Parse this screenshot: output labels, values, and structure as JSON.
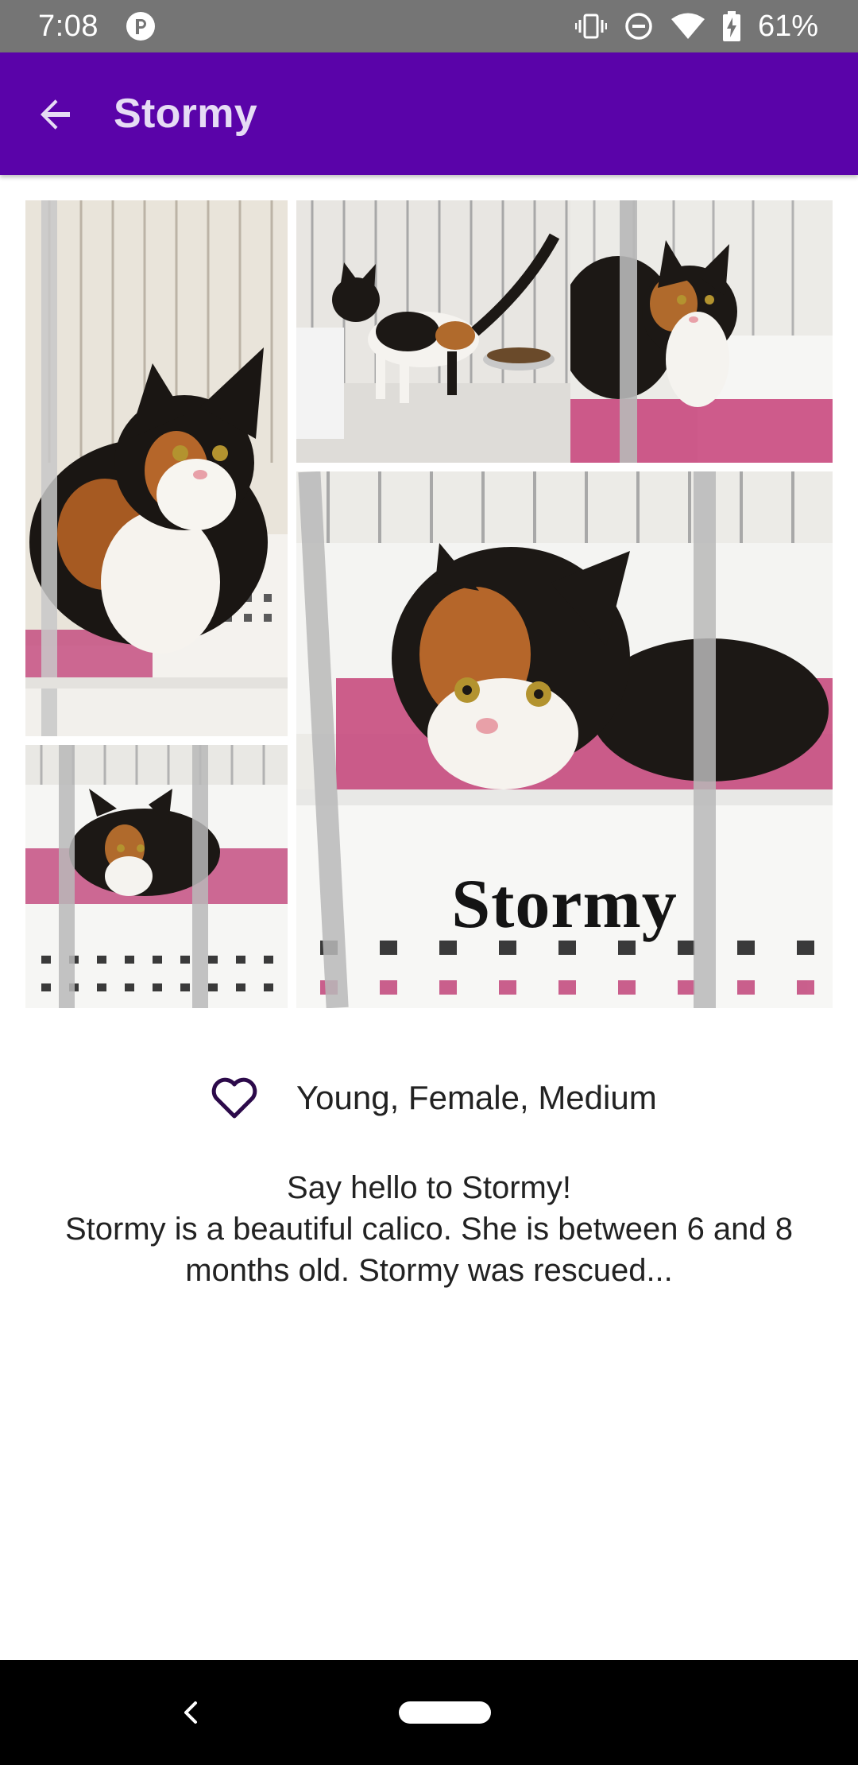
{
  "status_bar": {
    "time": "7:08",
    "battery": "61%",
    "icons": [
      "app-notification-icon",
      "vibrate-icon",
      "do-not-disturb-icon",
      "wifi-icon",
      "battery-charging-icon"
    ]
  },
  "app_bar": {
    "title": "Stormy",
    "back_icon": "arrow-back-icon"
  },
  "gallery": {
    "photo_count": 5,
    "watermark_text": "Stormy"
  },
  "details": {
    "attributes": "Young, Female, Medium",
    "favorite_icon": "heart-outline-icon",
    "description": "Say hello to Stormy!\nStormy is a beautiful calico.  She is between 6 and 8 months old.  Stormy was rescued..."
  },
  "nav_bar": {
    "icons": [
      "nav-back-icon",
      "nav-home-pill"
    ]
  },
  "colors": {
    "status_bar": "#757575",
    "app_bar": "#5a03a9",
    "title_text": "#e6dcf5",
    "heart": "#2c0a4a",
    "text": "#222222",
    "nav_bar": "#000000"
  }
}
